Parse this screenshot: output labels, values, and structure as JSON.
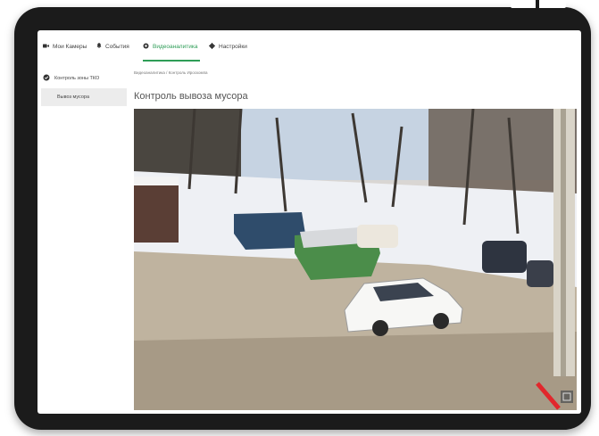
{
  "nav": {
    "items": [
      {
        "label": "Мои Камеры",
        "icon": "camera-icon"
      },
      {
        "label": "События",
        "icon": "bell-icon"
      },
      {
        "label": "Видеоаналитика",
        "icon": "analytics-icon"
      },
      {
        "label": "Настройки",
        "icon": "gear-icon"
      }
    ],
    "active_index": 2
  },
  "sidebar": {
    "group_label": "Контроль зоны ТКО",
    "group_icon": "shield-icon",
    "items": [
      {
        "label": "Вывоз мусора"
      }
    ]
  },
  "breadcrumb": "Видеоаналитика / Контроль Ироскомпа",
  "page": {
    "title": "Контроль вывоза мусора"
  },
  "colors": {
    "accent": "#2e9d57",
    "device_frame": "#1b1b1b"
  }
}
